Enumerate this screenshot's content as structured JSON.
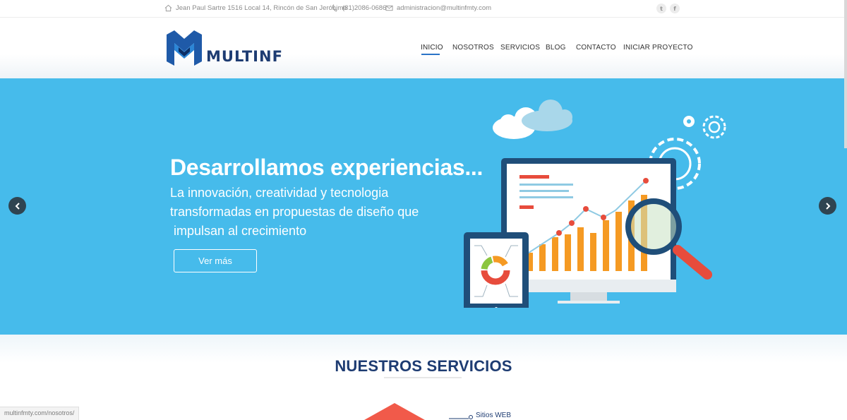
{
  "topbar": {
    "address": "Jean Paul Sartre 1516 Local 14, Rincón de San Jerónimo",
    "phone": "(81)2086-0686",
    "email": "administracion@multinfmty.com",
    "social": [
      {
        "name": "twitter",
        "glyph": "t"
      },
      {
        "name": "facebook",
        "glyph": "f"
      }
    ]
  },
  "header": {
    "logo_text": "MULTINF",
    "nav": [
      {
        "label": "INICIO",
        "active": true
      },
      {
        "label": "NOSOTROS",
        "active": false
      },
      {
        "label": "SERVICIOS",
        "active": false
      },
      {
        "label": "BLOG",
        "active": false
      },
      {
        "label": "CONTACTO",
        "active": false
      },
      {
        "label": "INICIAR PROYECTO",
        "active": false
      }
    ]
  },
  "hero": {
    "title": "Desarrollamos experiencias...",
    "subtitle_lines": [
      "La innovación, creatividad y tecnologia",
      "transformadas en propuestas de diseño que",
      " impulsan al crecimiento"
    ],
    "button_label": "Ver más",
    "bg_color": "#46bbeb"
  },
  "services": {
    "title": "NUESTROS SERVICIOS",
    "first_item": "Sitios WEB"
  },
  "status_bar": {
    "url": "multinfmty.com/nosotros/"
  },
  "colors": {
    "brand_navy": "#1e3c72",
    "accent_blue": "#2a73c7",
    "hero_blue": "#46bbeb",
    "chart_orange": "#f59a23",
    "chart_red": "#e74c3c"
  },
  "icons": {
    "address": "home-icon",
    "phone": "phone-icon",
    "email": "envelope-icon",
    "prev": "chevron-left-icon",
    "next": "chevron-right-icon"
  }
}
